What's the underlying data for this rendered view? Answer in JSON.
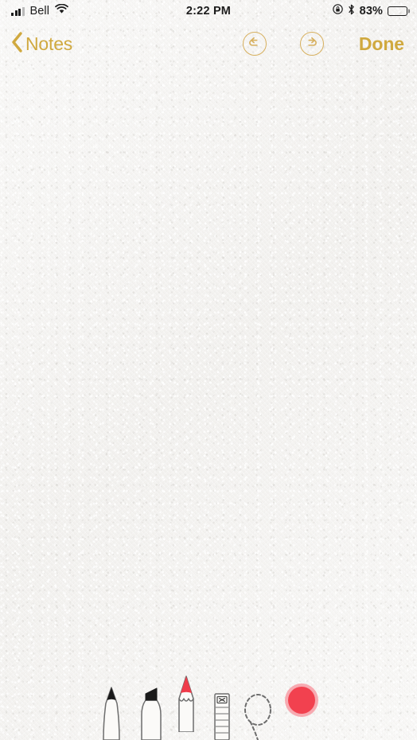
{
  "status_bar": {
    "carrier": "Bell",
    "signal_bars_filled": 3,
    "signal_bars_total": 4,
    "wifi_icon": "wifi-icon",
    "time": "2:22 PM",
    "rotation_lock_icon": "rotation-lock-icon",
    "bluetooth_icon": "bluetooth-icon",
    "battery_percent": "83%",
    "battery_level": 83,
    "battery_icon": "battery-icon"
  },
  "nav_bar": {
    "back_icon": "chevron-left-icon",
    "back_label": "Notes",
    "undo_icon": "undo-arrow-icon",
    "undo_label": "Undo",
    "redo_icon": "redo-arrow-icon",
    "redo_label": "Redo",
    "done_label": "Done",
    "accent_color": "#d0a93f"
  },
  "canvas": {
    "label": "Drawing canvas",
    "background_color": "#f4f3f1",
    "content": ""
  },
  "toolbar": {
    "tools": [
      {
        "name": "pen-tool",
        "label": "Pen",
        "selected": false
      },
      {
        "name": "marker-tool",
        "label": "Marker",
        "selected": false
      },
      {
        "name": "pencil-tool",
        "label": "Pencil",
        "selected": true
      },
      {
        "name": "eraser-tool",
        "label": "Eraser",
        "selected": false
      },
      {
        "name": "lasso-tool",
        "label": "Lasso",
        "selected": false
      }
    ],
    "color_swatch": {
      "label": "Color",
      "color": "#f2414f",
      "ring_color": "#f7aab1"
    }
  }
}
